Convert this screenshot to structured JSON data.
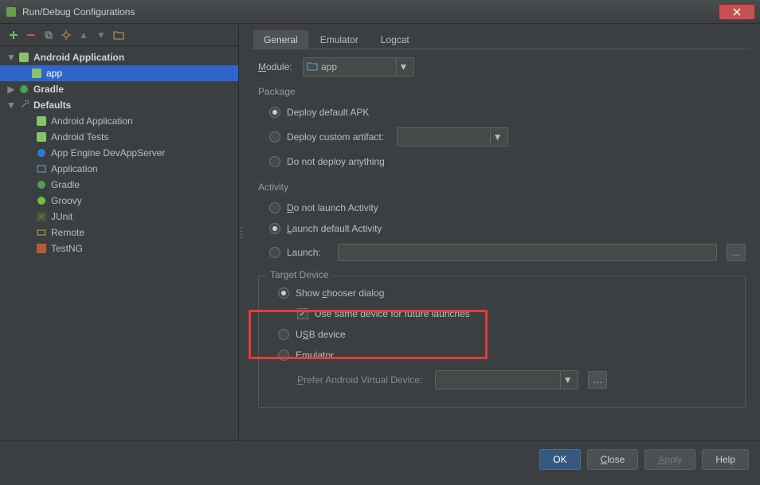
{
  "title": "Run/Debug Configurations",
  "tree": {
    "android_app": "Android Application",
    "app": "app",
    "gradle": "Gradle",
    "defaults": "Defaults",
    "d_android_app": "Android Application",
    "d_android_tests": "Android Tests",
    "d_app_engine": "App Engine DevAppServer",
    "d_application": "Application",
    "d_gradle": "Gradle",
    "d_groovy": "Groovy",
    "d_junit": "JUnit",
    "d_remote": "Remote",
    "d_testng": "TestNG"
  },
  "tabs": {
    "general": "General",
    "emulator": "Emulator",
    "logcat": "Logcat"
  },
  "module": {
    "label": "Module:",
    "value": "app"
  },
  "package": {
    "title": "Package",
    "default_apk": "Deploy default APK",
    "custom": "Deploy custom artifact:",
    "none": "Do not deploy anything"
  },
  "activity": {
    "title": "Activity",
    "no_launch": "Do not launch Activity",
    "default": "Launch default Activity",
    "launch": "Launch:"
  },
  "target": {
    "title": "Target Device",
    "chooser": "Show chooser dialog",
    "same_device": "Use same device for future launches",
    "usb": "USB device",
    "emulator": "Emulator",
    "avd": "Prefer Android Virtual Device:"
  },
  "buttons": {
    "ok": "OK",
    "close": "Close",
    "apply": "Apply",
    "help": "Help"
  }
}
